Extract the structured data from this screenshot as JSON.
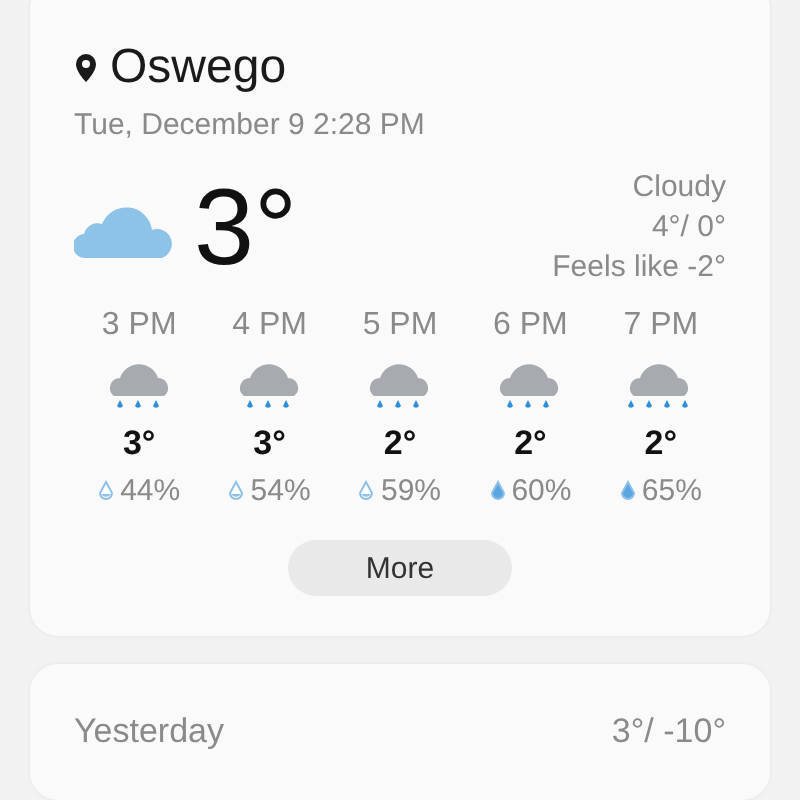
{
  "location": {
    "name": "Oswego",
    "datetime": "Tue, December 9 2:28 PM"
  },
  "current": {
    "temperature": "3°",
    "condition": "Cloudy",
    "high_low": "4°/ 0°",
    "feels_like": "Feels like -2°"
  },
  "hourly": [
    {
      "time": "3 PM",
      "kind": "rain",
      "temperature": "3°",
      "drop_filled": false,
      "chance": "44%"
    },
    {
      "time": "4 PM",
      "kind": "rain",
      "temperature": "3°",
      "drop_filled": false,
      "chance": "54%"
    },
    {
      "time": "5 PM",
      "kind": "rain",
      "temperature": "2°",
      "drop_filled": false,
      "chance": "59%"
    },
    {
      "time": "6 PM",
      "kind": "rain",
      "temperature": "2°",
      "drop_filled": true,
      "chance": "60%"
    },
    {
      "time": "7 PM",
      "kind": "heavy_rain",
      "temperature": "2°",
      "drop_filled": true,
      "chance": "65%"
    }
  ],
  "more_button": "More",
  "yesterday": {
    "label": "Yesterday",
    "high_low": "3°/ -10°"
  }
}
